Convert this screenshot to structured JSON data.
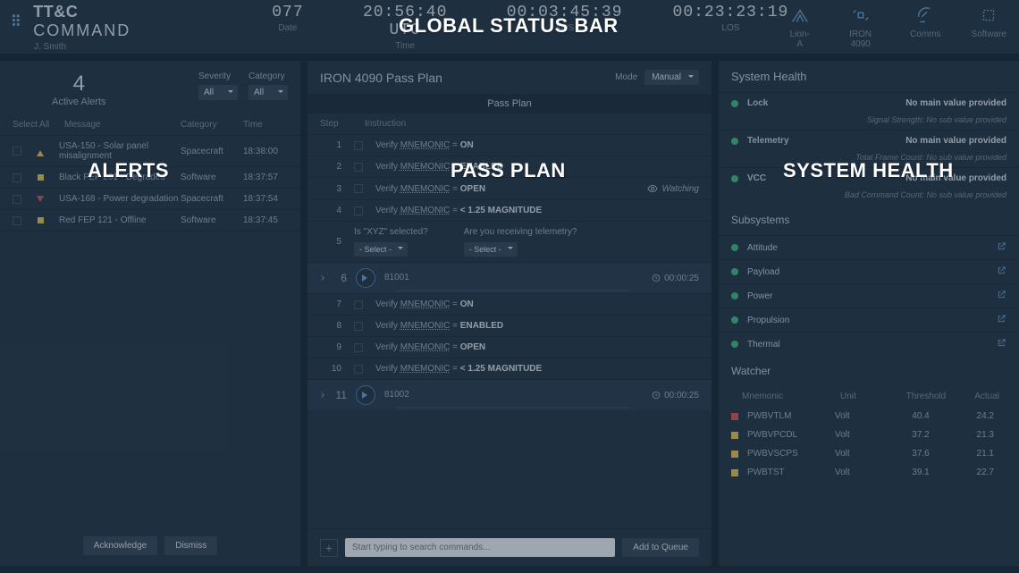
{
  "header": {
    "brand_bold": "TT&C",
    "brand_thin": "COMMAND",
    "user": "J. Smith",
    "clock": [
      {
        "val": "077",
        "lbl": "Date"
      },
      {
        "val": "20:56:40 UTC",
        "lbl": "Time"
      },
      {
        "val": "00:03:45:39",
        "lbl": "AOS"
      },
      {
        "val": "00:23:23:19",
        "lbl": "LOS"
      }
    ],
    "status": [
      {
        "lbl": "Lion-A",
        "icon": "antenna"
      },
      {
        "lbl": "IRON 4090",
        "icon": "satellite"
      },
      {
        "lbl": "Comms",
        "icon": "dish"
      },
      {
        "lbl": "Software",
        "icon": "cpu"
      }
    ]
  },
  "alerts": {
    "count": "4",
    "count_lbl": "Active Alerts",
    "filters": [
      {
        "lbl": "Severity",
        "val": "All"
      },
      {
        "lbl": "Category",
        "val": "All"
      }
    ],
    "head": {
      "sel": "Select All",
      "msg": "Message",
      "cat": "Category",
      "time": "Time"
    },
    "rows": [
      {
        "sev": "caution",
        "msg": "USA-150 - Solar panel misalignment",
        "cat": "Spacecraft",
        "time": "18:38:00"
      },
      {
        "sev": "square",
        "msg": "Black FEP 201 - Degraded",
        "cat": "Software",
        "time": "18:37:57"
      },
      {
        "sev": "critical",
        "msg": "USA-168 - Power degradation",
        "cat": "Spacecraft",
        "time": "18:37:54"
      },
      {
        "sev": "square",
        "msg": "Red FEP 121 - Offline",
        "cat": "Software",
        "time": "18:37:45"
      }
    ],
    "ack": "Acknowledge",
    "dismiss": "Dismiss"
  },
  "pass": {
    "title": "IRON 4090 Pass Plan",
    "mode_lbl": "Mode",
    "mode_val": "Manual",
    "sub": "Pass Plan",
    "th": {
      "step": "Step",
      "instr": "Instruction"
    },
    "verify": "Verify",
    "mn": "MNEMONIC",
    "steps": [
      {
        "n": "1",
        "val": "ON"
      },
      {
        "n": "2",
        "val": "ENABLED"
      },
      {
        "n": "3",
        "val": "OPEN",
        "watching": "Watching"
      },
      {
        "n": "4",
        "val": "< 1.25 MAGNITUDE"
      }
    ],
    "qstep": "5",
    "q1": "Is \"XYZ\" selected?",
    "q2": "Are you receiving telemetry?",
    "qsel": "- Select -",
    "cmd1": {
      "n": "6",
      "id": "81001",
      "dur": "00:00:25"
    },
    "steps2": [
      {
        "n": "7",
        "val": "ON"
      },
      {
        "n": "8",
        "val": "ENABLED"
      },
      {
        "n": "9",
        "val": "OPEN"
      },
      {
        "n": "10",
        "val": "< 1.25 MAGNITUDE"
      }
    ],
    "cmd2": {
      "n": "11",
      "id": "81002",
      "dur": "00:00:25"
    },
    "search_ph": "Start typing to search commands...",
    "queue": "Add to Queue"
  },
  "health": {
    "title": "System Health",
    "main": [
      {
        "dot": "g",
        "name": "Lock",
        "val": "No main value provided",
        "sub": "Signal Strength:  No sub value provided"
      },
      {
        "dot": "g",
        "name": "Telemetry",
        "val": "No main value provided",
        "sub": "Total Frame Count:  No sub value provided"
      },
      {
        "dot": "g",
        "name": "VCC",
        "val": "No main value provided",
        "sub": "Bad Command Count:  No sub value provided"
      }
    ],
    "subtitle": "Subsystems",
    "sub": [
      {
        "dot": "g",
        "name": "Attitude"
      },
      {
        "dot": "g",
        "name": "Payload"
      },
      {
        "dot": "g",
        "name": "Power"
      },
      {
        "dot": "g",
        "name": "Propulsion"
      },
      {
        "dot": "g",
        "name": "Thermal"
      }
    ],
    "watcher": "Watcher",
    "wth": {
      "m": "Mnemonic",
      "u": "Unit",
      "t": "Threshold",
      "a": "Actual"
    },
    "wrows": [
      {
        "c": "r",
        "m": "PWBVTLM",
        "u": "Volt",
        "t": "40.4",
        "a": "24.2"
      },
      {
        "c": "y",
        "m": "PWBVPCDL",
        "u": "Volt",
        "t": "37.2",
        "a": "21.3"
      },
      {
        "c": "y",
        "m": "PWBVSCPS",
        "u": "Volt",
        "t": "37.6",
        "a": "21.1"
      },
      {
        "c": "y",
        "m": "PWBTST",
        "u": "Volt",
        "t": "39.1",
        "a": "22.7"
      }
    ]
  },
  "labels": {
    "gsb": "GLOBAL STATUS BAR",
    "alerts": "ALERTS",
    "pass": "PASS PLAN",
    "health": "SYSTEM HEALTH"
  }
}
